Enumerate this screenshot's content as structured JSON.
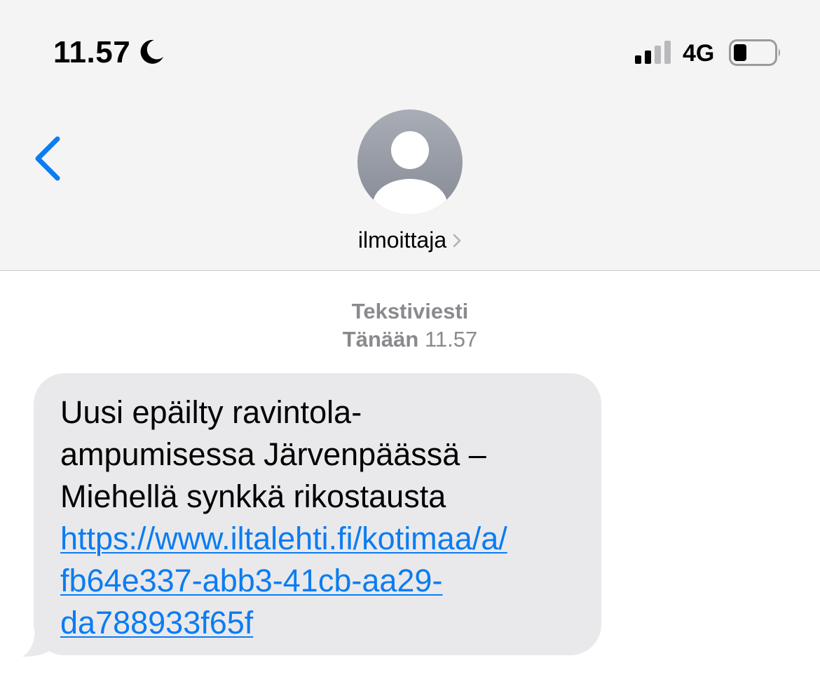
{
  "status_bar": {
    "time": "11.57",
    "focus_icon": "moon-icon",
    "signal_icon": "signal-bars-icon",
    "network": "4G",
    "battery_icon": "battery-icon"
  },
  "nav": {
    "back_icon": "chevron-left-icon",
    "avatar_icon": "person-silhouette-icon",
    "contact_name": "ilmoittaja",
    "contact_chevron_icon": "chevron-right-icon"
  },
  "conversation": {
    "message_type": "Tekstiviesti",
    "timestamp_day": "Tänään",
    "timestamp_time": "11.57",
    "messages": [
      {
        "direction": "incoming",
        "lines": [
          "Uusi epäilty ravintola-",
          "ampumisessa Järvenpäässä –",
          "Miehellä synkkä rikostausta"
        ],
        "link_lines": [
          "https://www.iltalehti.fi/kotimaa/a/",
          "fb64e337-abb3-41cb-aa29-",
          "da788933f65f"
        ]
      }
    ]
  },
  "colors": {
    "header_bg": "#f4f4f4",
    "accent_blue": "#0b7cf2",
    "bubble_bg": "#e9e9eb",
    "meta_gray": "#8a8a8e",
    "avatar_gray": "#9fa3ac"
  }
}
